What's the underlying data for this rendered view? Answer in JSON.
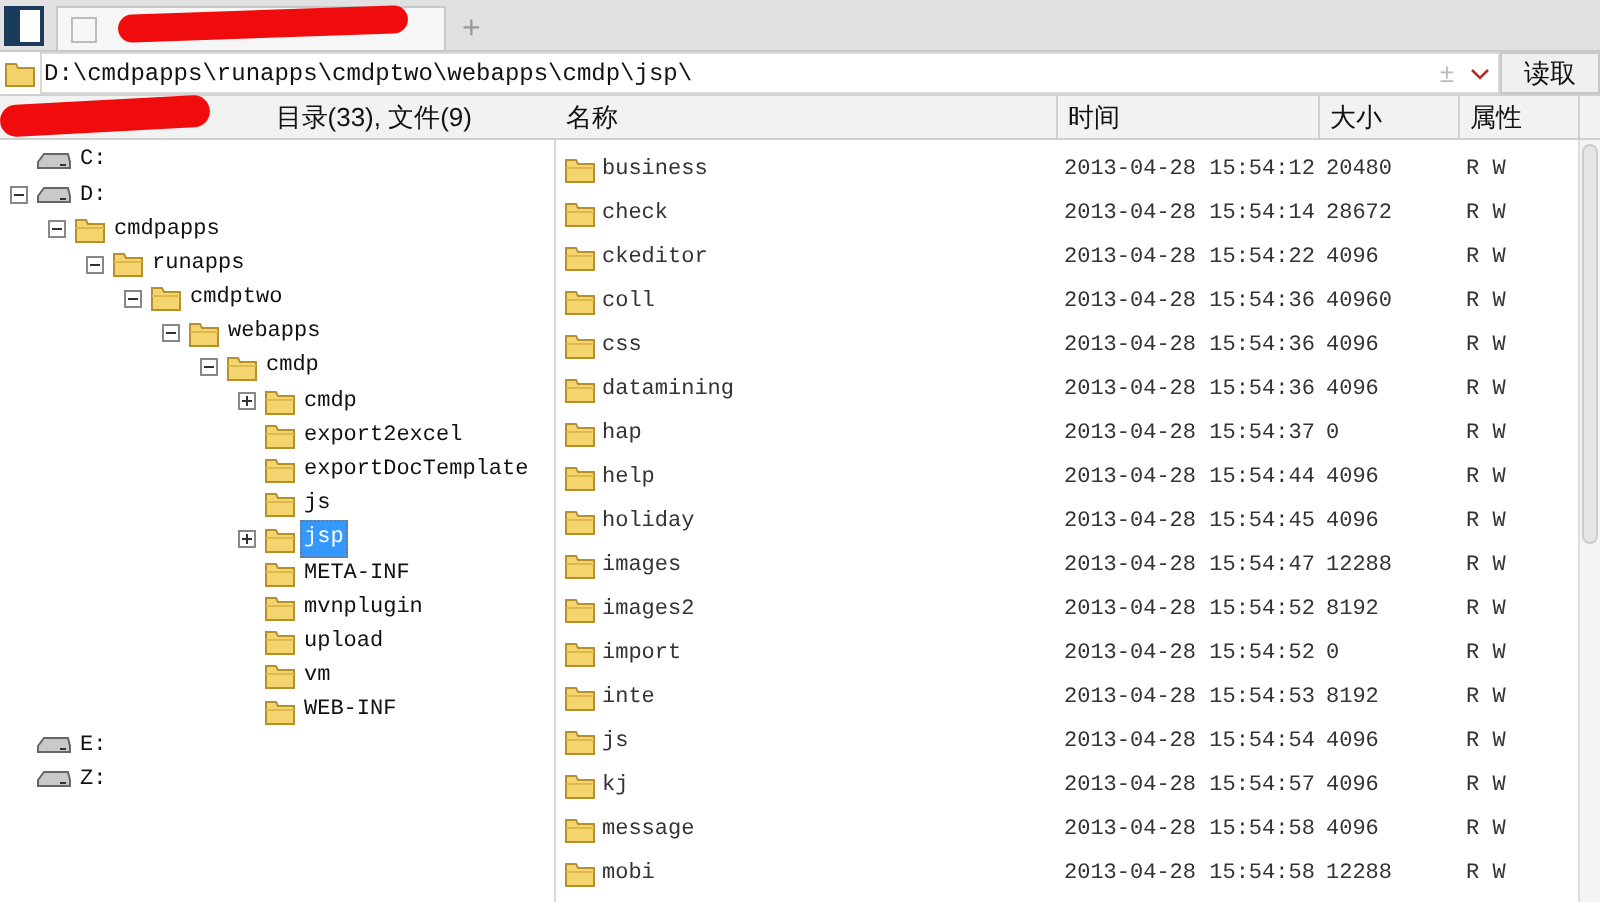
{
  "tab_bar": {
    "tabs": [
      {
        "selected": true
      }
    ],
    "new_tab": "+"
  },
  "address_bar": {
    "value": "D:\\cmdpapps\\runapps\\cmdptwo\\webapps\\cmdp\\jsp\\",
    "plus_minus": "±",
    "read_button": "读取"
  },
  "tree_header": {
    "summary": "目录(33), 文件(9)"
  },
  "tree": [
    {
      "kind": "drive",
      "label": "C:",
      "selected": false
    },
    {
      "kind": "drive",
      "label": "D:",
      "selected": false,
      "expanded": true,
      "children": [
        {
          "kind": "folder",
          "label": "cmdpapps",
          "selected": false,
          "expanded": true,
          "children": [
            {
              "kind": "folder",
              "label": "runapps",
              "selected": false,
              "expanded": true,
              "children": [
                {
                  "kind": "folder",
                  "label": "cmdptwo",
                  "selected": false,
                  "expanded": true,
                  "children": [
                    {
                      "kind": "folder",
                      "label": "webapps",
                      "selected": false,
                      "expanded": true,
                      "children": [
                        {
                          "kind": "folder",
                          "label": "cmdp",
                          "selected": false,
                          "expanded": true,
                          "children": [
                            {
                              "kind": "folder",
                              "label": "cmdp",
                              "selected": false,
                              "expanded": false
                            },
                            {
                              "kind": "folder",
                              "label": "export2excel",
                              "selected": false
                            },
                            {
                              "kind": "folder",
                              "label": "exportDocTemplate",
                              "selected": false
                            },
                            {
                              "kind": "folder",
                              "label": "js",
                              "selected": false
                            },
                            {
                              "kind": "folder",
                              "label": "jsp",
                              "selected": true,
                              "expanded": false
                            },
                            {
                              "kind": "folder",
                              "label": "META-INF",
                              "selected": false
                            },
                            {
                              "kind": "folder",
                              "label": "mvnplugin",
                              "selected": false
                            },
                            {
                              "kind": "folder",
                              "label": "upload",
                              "selected": false
                            },
                            {
                              "kind": "folder",
                              "label": "vm",
                              "selected": false
                            },
                            {
                              "kind": "folder",
                              "label": "WEB-INF",
                              "selected": false
                            }
                          ]
                        }
                      ]
                    }
                  ]
                }
              ]
            }
          ]
        }
      ]
    },
    {
      "kind": "drive",
      "label": "E:",
      "selected": false
    },
    {
      "kind": "drive",
      "label": "Z:",
      "selected": false
    }
  ],
  "table": {
    "columns": [
      "名称",
      "时间",
      "大小",
      "属性"
    ],
    "rows": [
      [
        "business",
        "2013-04-28 15:54:12",
        "20480",
        "R W"
      ],
      [
        "check",
        "2013-04-28 15:54:14",
        "28672",
        "R W"
      ],
      [
        "ckeditor",
        "2013-04-28 15:54:22",
        "4096",
        "R W"
      ],
      [
        "coll",
        "2013-04-28 15:54:36",
        "40960",
        "R W"
      ],
      [
        "css",
        "2013-04-28 15:54:36",
        "4096",
        "R W"
      ],
      [
        "datamining",
        "2013-04-28 15:54:36",
        "4096",
        "R W"
      ],
      [
        "hap",
        "2013-04-28 15:54:37",
        "0",
        "R W"
      ],
      [
        "help",
        "2013-04-28 15:54:44",
        "4096",
        "R W"
      ],
      [
        "holiday",
        "2013-04-28 15:54:45",
        "4096",
        "R W"
      ],
      [
        "images",
        "2013-04-28 15:54:47",
        "12288",
        "R W"
      ],
      [
        "images2",
        "2013-04-28 15:54:52",
        "8192",
        "R W"
      ],
      [
        "import",
        "2013-04-28 15:54:52",
        "0",
        "R W"
      ],
      [
        "inte",
        "2013-04-28 15:54:53",
        "8192",
        "R W"
      ],
      [
        "js",
        "2013-04-28 15:54:54",
        "4096",
        "R W"
      ],
      [
        "kj",
        "2013-04-28 15:54:57",
        "4096",
        "R W"
      ],
      [
        "message",
        "2013-04-28 15:54:58",
        "4096",
        "R W"
      ],
      [
        "mobi",
        "2013-04-28 15:54:58",
        "12288",
        "R W"
      ]
    ]
  }
}
